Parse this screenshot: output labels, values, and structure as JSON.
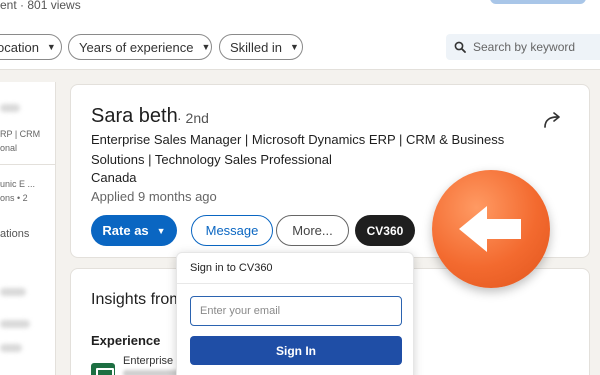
{
  "top": {
    "meta_text": "ent · 801 views"
  },
  "filters": [
    {
      "label": "ocation"
    },
    {
      "label": "Years of experience"
    },
    {
      "label": "Skilled in"
    }
  ],
  "search": {
    "placeholder": "Search by keyword",
    "icon": "search-icon"
  },
  "left_column": {
    "line1": "RP | CRM",
    "line2": "onal",
    "line3": "unic E ...",
    "line4": "ons • 2",
    "line5": "ations"
  },
  "candidate": {
    "name": "Sara beth",
    "degree": "· 2nd",
    "headline": "Enterprise Sales Manager | Microsoft Dynamics ERP | CRM & Business Solutions | Technology Sales Professional",
    "location": "Canada",
    "applied": "Applied 9 months ago"
  },
  "actions": {
    "rate_label": "Rate as",
    "message_label": "Message",
    "more_label": "More...",
    "cv_label": "CV360"
  },
  "insights": {
    "title": "Insights from",
    "experience_label": "Experience",
    "experience_item": "Enterprise S"
  },
  "cv360_popup": {
    "title": "Sign in to CV360",
    "email_placeholder": "Enter your email",
    "signin_label": "Sign In"
  },
  "colors": {
    "primary": "#0a66c2",
    "signin": "#1f4ea6",
    "badge": "#f36a2f"
  }
}
